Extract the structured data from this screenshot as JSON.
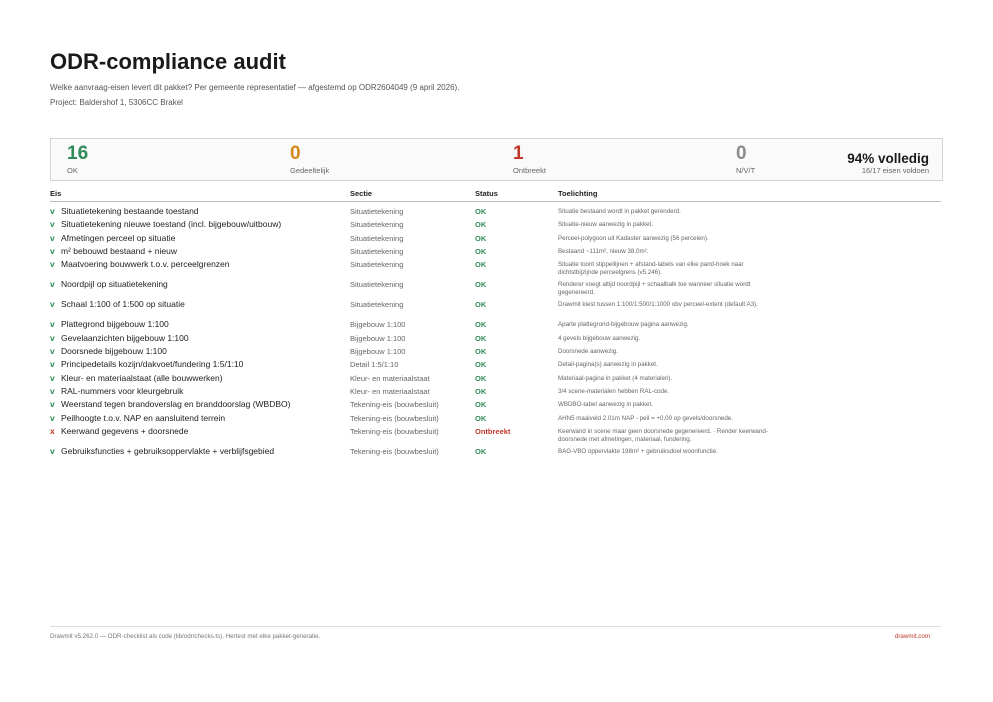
{
  "title": "ODR-compliance audit",
  "subtitle": "Welke aanvraag-eisen levert dit pakket? Per gemeente representatief — afgestemd op ODR2604049 (9 april 2026).",
  "project": "Project: Baldershof 1, 5306CC Brakel",
  "summary": {
    "ok": {
      "value": "16",
      "label": "OK"
    },
    "partial": {
      "value": "0",
      "label": "Gedeeltelijk"
    },
    "missing": {
      "value": "1",
      "label": "Ontbreekt"
    },
    "na": {
      "value": "0",
      "label": "N/V/T"
    },
    "complete": {
      "percent": "94% volledig",
      "detail": "16/17 eisen voldoen"
    }
  },
  "table": {
    "headers": {
      "eis": "Eis",
      "sectie": "Sectie",
      "status": "Status",
      "toelichting": "Toelichting"
    },
    "rows": [
      {
        "mark": "v",
        "eis": "Situatietekening bestaande toestand",
        "sectie": "Situatietekening",
        "status": "OK",
        "toelichting": "Situatie bestaand wordt in pakket gerenderd."
      },
      {
        "mark": "v",
        "eis": "Situatietekening nieuwe toestand (incl. bijgebouw/uitbouw)",
        "sectie": "Situatietekening",
        "status": "OK",
        "toelichting": "Situatie-nieuw aanwezig in pakket."
      },
      {
        "mark": "v",
        "eis": "Afmetingen perceel op situatie",
        "sectie": "Situatietekening",
        "status": "OK",
        "toelichting": "Perceel-polygoon uit Kadaster aanwezig (56 percelen)."
      },
      {
        "mark": "v",
        "eis": "m² bebouwd bestaand + nieuw",
        "sectie": "Situatietekening",
        "status": "OK",
        "toelichting": "Bestaand ~111m², nieuw 38.0m²."
      },
      {
        "mark": "v",
        "eis": "Maatvoering bouwwerk t.o.v. perceelgrenzen",
        "sectie": "Situatietekening",
        "status": "OK",
        "toelichting": "Situatie toont stippellijnen + afstand-labels van elke pand-hoek naar dichtstbijzijnde perceelgrens (v5.246)."
      },
      {
        "mark": "v",
        "eis": "Noordpijl op situatietekening",
        "sectie": "Situatietekening",
        "status": "OK",
        "toelichting": "Renderer voegt altijd noordpijl + schaalbalk toe wanneer situatie wordt gegenereerd."
      },
      {
        "mark": "v",
        "eis": "Schaal 1:100 of 1:500 op situatie",
        "sectie": "Situatietekening",
        "status": "OK",
        "toelichting": "Drawmit kiest tussen 1:100/1:500/1:1000 obv perceel-extent (default A3)."
      },
      {
        "mark": "v",
        "eis": "Plattegrond bijgebouw 1:100",
        "sectie": "Bijgebouw 1:100",
        "status": "OK",
        "toelichting": "Aparte plattegrond-bijgebouw pagina aanwezig."
      },
      {
        "mark": "v",
        "eis": "Gevelaanzichten bijgebouw 1:100",
        "sectie": "Bijgebouw 1:100",
        "status": "OK",
        "toelichting": "4 gevels bijgebouw aanwezig."
      },
      {
        "mark": "v",
        "eis": "Doorsnede bijgebouw 1:100",
        "sectie": "Bijgebouw 1:100",
        "status": "OK",
        "toelichting": "Doorsnede aanwezig."
      },
      {
        "mark": "v",
        "eis": "Principedetails kozijn/dakvoet/fundering 1:5/1:10",
        "sectie": "Detail 1:5/1:10",
        "status": "OK",
        "toelichting": "Detail-pagina(s) aanwezig in pakket."
      },
      {
        "mark": "v",
        "eis": "Kleur- en materiaalstaat (alle bouwwerken)",
        "sectie": "Kleur- en materiaalstaat",
        "status": "OK",
        "toelichting": "Materiaal-pagina in pakket (4 materialen)."
      },
      {
        "mark": "v",
        "eis": "RAL-nummers voor kleurgebruik",
        "sectie": "Kleur- en materiaalstaat",
        "status": "OK",
        "toelichting": "3/4 scene-materialen hebben RAL-code."
      },
      {
        "mark": "v",
        "eis": "Weerstand tegen brandoverslag en branddoorslag (WBDBO)",
        "sectie": "Tekening-eis (bouwbesluit)",
        "status": "OK",
        "toelichting": "WBDBO-tabel aanwezig in pakket."
      },
      {
        "mark": "v",
        "eis": "Peilhoogte t.o.v. NAP en aansluitend terrein",
        "sectie": "Tekening-eis (bouwbesluit)",
        "status": "OK",
        "toelichting": "AHN5 maaiveld 2.01m NAP - peil = +0,00 op gevels/doorsnede."
      },
      {
        "mark": "x",
        "eis": "Keerwand gegevens + doorsnede",
        "sectie": "Tekening-eis (bouwbesluit)",
        "status": "Ontbreekt",
        "toelichting": "Keerwand in scene maar geen doorsnede gegenereerd. · Render keerwand-doorsnede met afmetingen, materiaal, fundering."
      },
      {
        "mark": "v",
        "eis": "Gebruiksfuncties + gebruiksoppervlakte + verblijfsgebied",
        "sectie": "Tekening-eis (bouwbesluit)",
        "status": "OK",
        "toelichting": "BAG-VBO oppervlakte 198m² + gebruiksdoel woonfunctie."
      }
    ]
  },
  "footer": {
    "left": "Drawmit v5.262.0 — ODR-checklist als code (lib/odr/checks.ts). Hertest met elke pakket-generatie.",
    "right": "drawmit.com"
  },
  "colors": {
    "ok": "#2e8b57",
    "partial": "#d4891a",
    "missing": "#c0392b",
    "na": "#8c8c8c"
  }
}
